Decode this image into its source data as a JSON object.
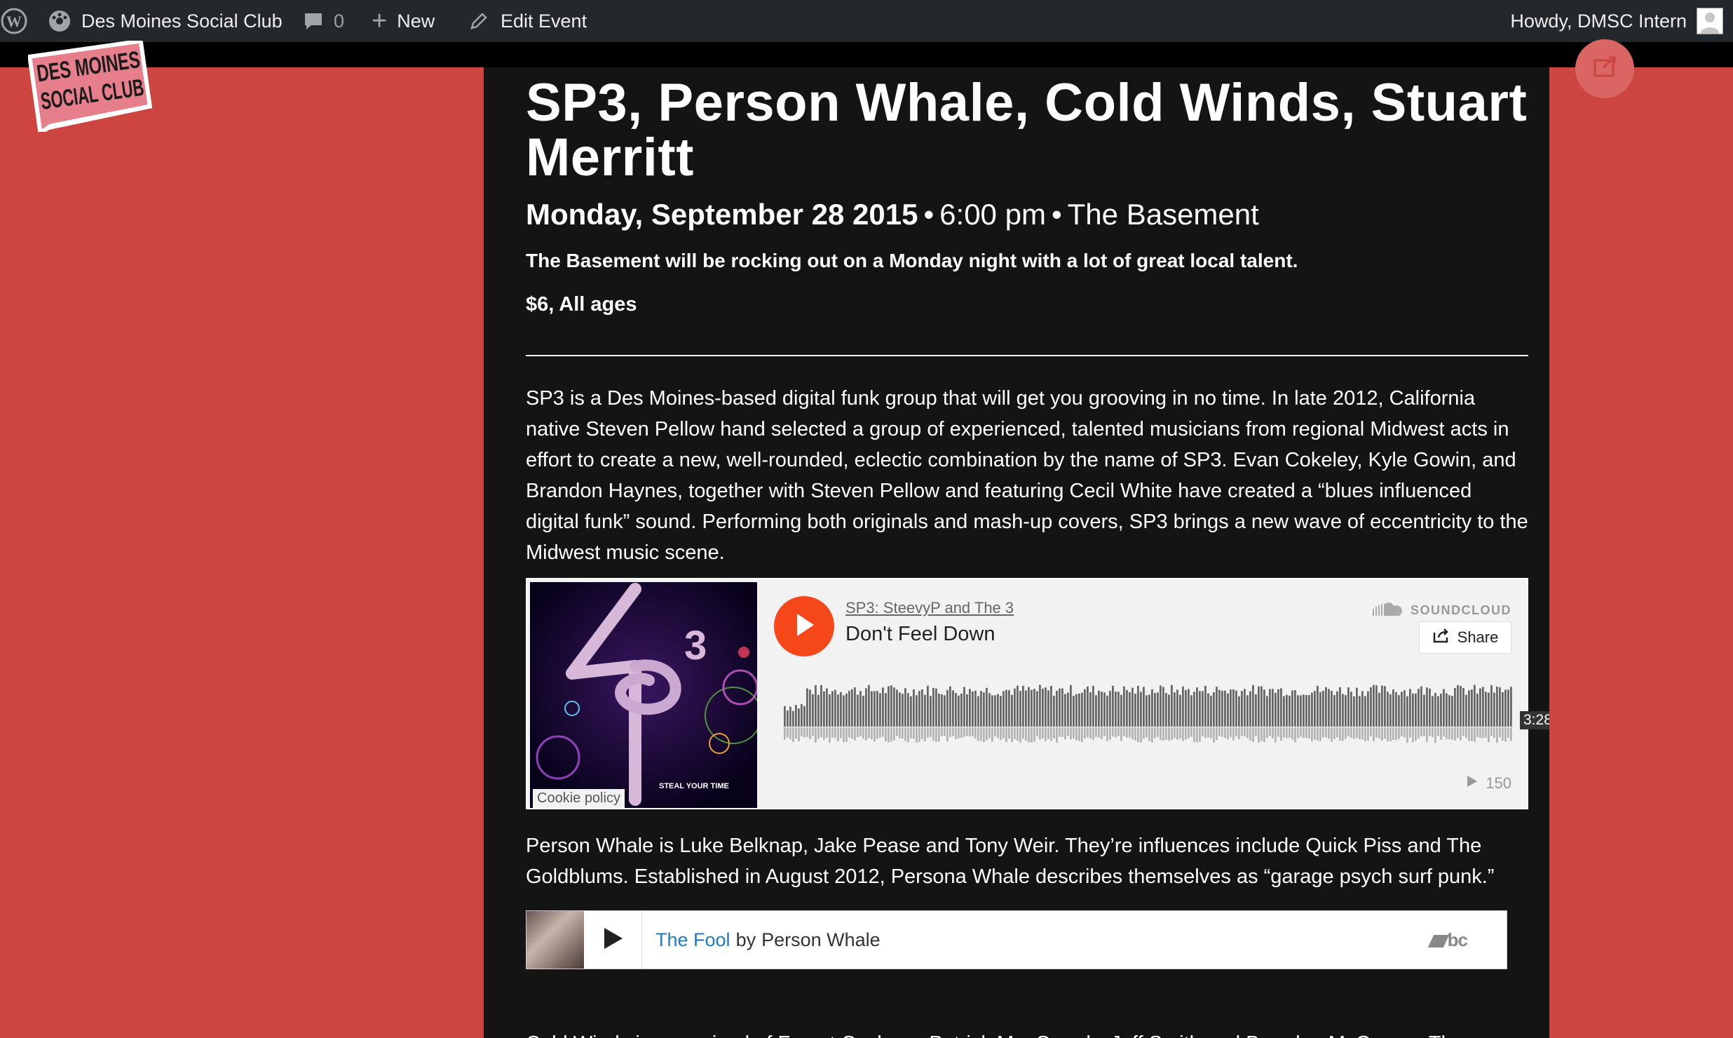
{
  "admin_bar": {
    "site_name": "Des Moines Social Club",
    "comments_count": "0",
    "new_label": "New",
    "edit_label": "Edit Event",
    "howdy": "Howdy, DMSC Intern"
  },
  "logo": {
    "line1": "DES MOINES",
    "line2": "SOCIAL CLUB"
  },
  "event": {
    "title": "SP3, Person Whale, Cold Winds, Stuart Merritt",
    "date": "Monday, September 28 2015",
    "separator": "•",
    "time": "6:00 pm",
    "venue": "The Basement",
    "summary": "The Basement will be rocking out on a Monday night with a lot of great local talent.",
    "price": "$6, All ages"
  },
  "paragraphs": {
    "sp3": "SP3 is a Des Moines-based digital funk group that will get you grooving in no time. In late 2012, California native Steven Pellow hand selected a group of experienced, talented musicians from regional Midwest acts in effort to create a new, well-rounded, eclectic combination by the name of SP3. Evan Cokeley, Kyle Gowin, and Brandon Haynes, together with Steven Pellow and featuring Cecil White have created a “blues influenced digital funk” sound. Performing both originals and mash-up covers, SP3 brings a new wave of eccentricity to the Midwest music scene.",
    "person_whale": "Person Whale is Luke Belknap, Jake Pease and Tony Weir. They’re influences include Quick Piss and The Goldblums. Established in August 2012, Persona Whale describes themselves as “garage psych surf punk.”",
    "cold_winds": "Cold Winds is comprised of Forest Cochran, Patrick MacCready, Jeff Smith and Brendan McGregor. They"
  },
  "soundcloud": {
    "artist": "SP3: SteevyP and The 3",
    "track": "Don't Feel Down",
    "brand": "SOUNDCLOUD",
    "share_label": "Share",
    "duration": "3:28",
    "plays": "150",
    "cookie_label": "Cookie policy",
    "art_caption": "STEAL YOUR TIME",
    "art_number": "3"
  },
  "bandcamp": {
    "track": "The Fool",
    "by": "by",
    "artist": "Person Whale",
    "logo": "bc"
  },
  "colors": {
    "page_bg": "#cc4540",
    "admin_bar": "#23282d",
    "content_bg": "#141414",
    "soundcloud_orange": "#f5471a",
    "bandcamp_link": "#1f78c8"
  }
}
